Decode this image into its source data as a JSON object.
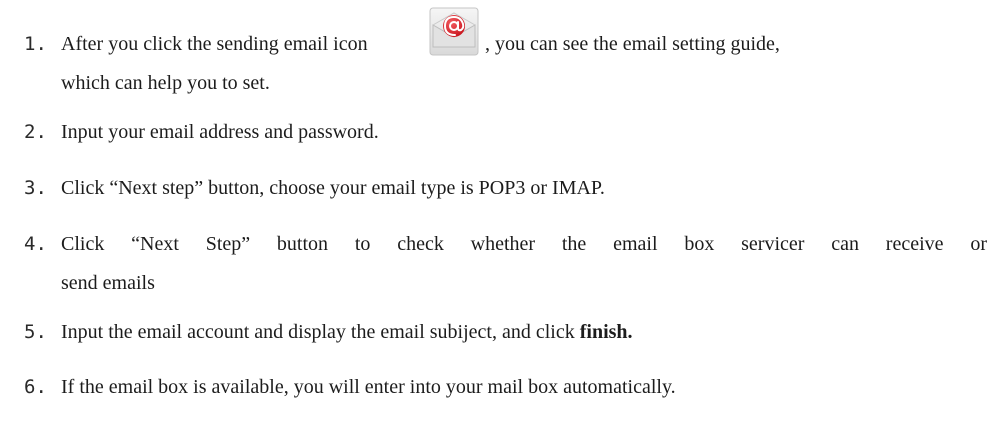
{
  "steps": [
    {
      "number": "1.",
      "text_before_icon": "After you click the sending email icon",
      "icon": "email-at-envelope-icon",
      "text_after_icon": ", you can see the email setting guide,",
      "continuation": "which can help you to set."
    },
    {
      "number": "2.",
      "text": "Input your email address and password."
    },
    {
      "number": "3.",
      "text": "Click “Next step” button, choose your email type is POP3 or IMAP."
    },
    {
      "number": "4.",
      "text": "Click “Next Step” button to check whether the email box servicer can receive or",
      "continuation": "send emails"
    },
    {
      "number": "5.",
      "text_before_bold": "Input the email account and display the email subiject, and click ",
      "bold": "finish."
    },
    {
      "number": "6.",
      "text": "If the email box is available, you will enter into your mail box automatically."
    }
  ],
  "colors": {
    "text": "#1c1c1c",
    "icon_red": "#d8232a",
    "icon_envelope": "#e9e9e9"
  }
}
